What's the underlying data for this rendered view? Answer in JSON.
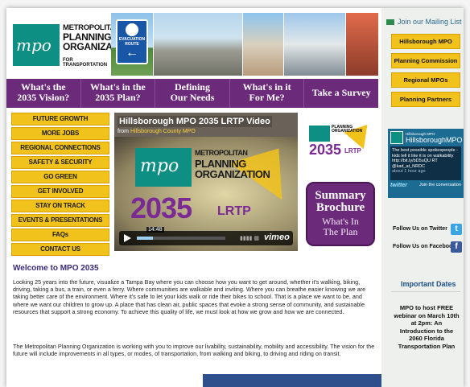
{
  "header": {
    "logo_line1": "METROPOLITAN",
    "logo_line2": "PLANNING",
    "logo_line3": "ORGANIZATION",
    "logo_sub": "FOR TRANSPORTATION",
    "logo_mark": "mpo",
    "evac_sign_line1": "EVACUATION",
    "evac_sign_line2": "ROUTE"
  },
  "topnav": [
    {
      "label1": "What's the",
      "label2": "2035 Vision?"
    },
    {
      "label1": "What's in the",
      "label2": "2035 Plan?"
    },
    {
      "label1": "Defining",
      "label2": "Our Needs"
    },
    {
      "label1": "What's in it",
      "label2": "For Me?"
    },
    {
      "label1": "Take a Survey",
      "label2": ""
    }
  ],
  "leftmenu": [
    "FUTURE GROWTH",
    "MORE JOBS",
    "REGIONAL CONNECTIONS",
    "SAFETY & SECURITY",
    "GO GREEN",
    "GET INVOLVED",
    "STAY ON TRACK",
    "EVENTS & PRESENTATIONS",
    "FAQs",
    "CONTACT US"
  ],
  "video": {
    "title": "Hillsborough MPO 2035 LRTP Video",
    "from_label": "from",
    "from_source": "Hillsborough County MPO",
    "logo_text": "mpo",
    "logo_caption1": "METROPOLITAN",
    "logo_caption2": "PLANNING",
    "logo_caption3": "ORGANIZATION",
    "big_number": "2035",
    "big_suffix": "LRTP",
    "time": "14:48",
    "provider": "vimeo",
    "progress": 0.18
  },
  "promo": {
    "lrtp_number": "2035",
    "lrtp_suffix": "LRTP",
    "summary_line1": "Summary",
    "summary_line2": "Brochure",
    "summary_line3": "What's In",
    "summary_line4": "The Plan"
  },
  "sidebar": {
    "mailing_list": "Join our Mailing List",
    "buttons": [
      "Hillsborough MPO",
      "Planning Commission",
      "Regional MPOs",
      "Planning Partners"
    ],
    "twitter": {
      "small_name": "Hillsborough MPO",
      "big_name": "HillsboroughMPO",
      "tweet": "The best possible spokespeople - kids tell it like it is on walkability http://bit.ly/bD5uQU RT @kad_at_NRDC",
      "time": "about 1 hour ago",
      "logo": "twitter",
      "join": "Join the conversation"
    },
    "follow_twitter": "Follow Us on Twitter",
    "follow_facebook": "Follow Us on Facebook",
    "important_dates": "Important Dates",
    "event_text": "MPO to host FREE webinar on March 10th at 2pm: An Introduction to the 2060 Florida Transportation Plan"
  },
  "main": {
    "welcome": "Welcome to MPO 2035",
    "para1": "Looking 25 years into the future, visualize a Tampa Bay where you can choose how you want to get around, whether it's walking, biking, driving, taking a bus, a train, or even a ferry. Where communities are walkable and inviting. Where you can breathe easier knowing we are taking better care of the environment. Where it's safe to let your kids walk or ride their bikes to school. That is a place we want to be, and where we want our children to grow up. A place that has clean air, public spaces that evoke a strong sense of community, and sustainable resources that support a strong economy. To achieve this quality of life, we must look at how we grow and how we are connected.",
    "para2": "The Metropolitan Planning Organization is working with you to improve our livability, sustainability, mobility and accessibility. The vision for the future will include improvements in all types, or modes, of transportation, from walking and biking, to driving and riding on transit."
  },
  "colors": {
    "purple": "#6b2a7a",
    "yellow": "#f2c21c",
    "teal": "#0d8f84"
  }
}
